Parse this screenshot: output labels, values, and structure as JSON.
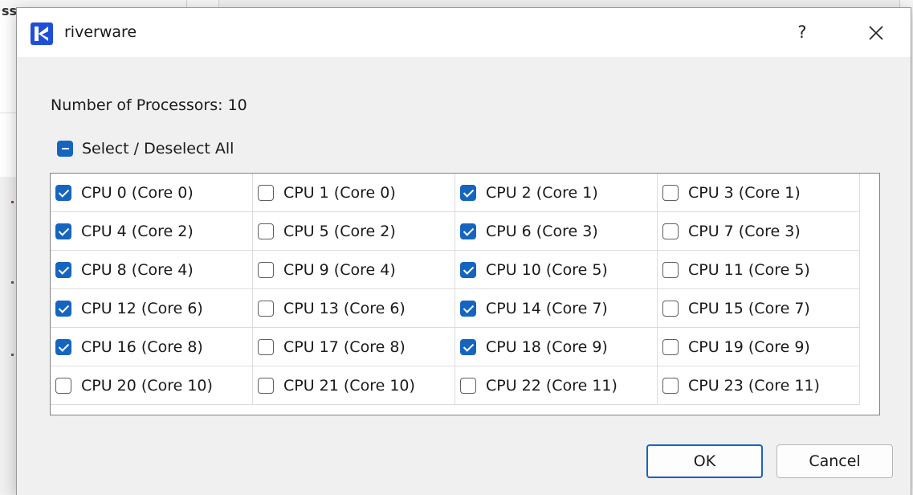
{
  "background": {
    "fragment_text": "ss"
  },
  "dialog": {
    "title": "riverware",
    "help_label": "?",
    "processors_label": "Number of Processors:  10",
    "select_all_label": "Select / Deselect All",
    "ok_label": "OK",
    "cancel_label": "Cancel"
  },
  "cpus": [
    {
      "label": "CPU 0 (Core 0)",
      "checked": true
    },
    {
      "label": "CPU 1 (Core 0)",
      "checked": false
    },
    {
      "label": "CPU 2 (Core 1)",
      "checked": true
    },
    {
      "label": "CPU 3 (Core 1)",
      "checked": false
    },
    {
      "label": "CPU 4 (Core 2)",
      "checked": true
    },
    {
      "label": "CPU 5 (Core 2)",
      "checked": false
    },
    {
      "label": "CPU 6 (Core 3)",
      "checked": true
    },
    {
      "label": "CPU 7 (Core 3)",
      "checked": false
    },
    {
      "label": "CPU 8 (Core 4)",
      "checked": true
    },
    {
      "label": "CPU 9 (Core 4)",
      "checked": false
    },
    {
      "label": "CPU 10 (Core 5)",
      "checked": true
    },
    {
      "label": "CPU 11 (Core 5)",
      "checked": false
    },
    {
      "label": "CPU 12 (Core 6)",
      "checked": true
    },
    {
      "label": "CPU 13 (Core 6)",
      "checked": false
    },
    {
      "label": "CPU 14 (Core 7)",
      "checked": true
    },
    {
      "label": "CPU 15 (Core 7)",
      "checked": false
    },
    {
      "label": "CPU 16 (Core 8)",
      "checked": true
    },
    {
      "label": "CPU 17 (Core 8)",
      "checked": false
    },
    {
      "label": "CPU 18 (Core 9)",
      "checked": true
    },
    {
      "label": "CPU 19 (Core 9)",
      "checked": false
    },
    {
      "label": "CPU 20 (Core 10)",
      "checked": false
    },
    {
      "label": "CPU 21 (Core 10)",
      "checked": false
    },
    {
      "label": "CPU 22 (Core 11)",
      "checked": false
    },
    {
      "label": "CPU 23 (Core 11)",
      "checked": false
    }
  ],
  "colors": {
    "accent": "#1565c0",
    "logo": "#1f4fd6"
  },
  "icons": {
    "logo": "riverware-logo-icon",
    "close": "close-icon"
  }
}
